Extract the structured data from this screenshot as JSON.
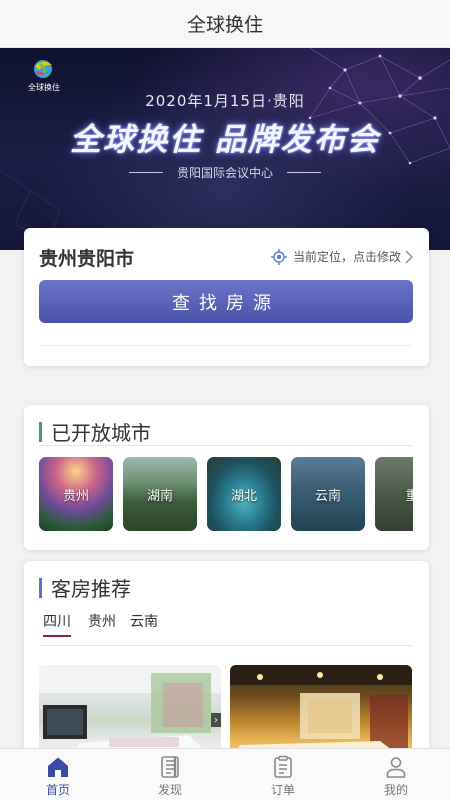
{
  "header": {
    "title": "全球换住"
  },
  "banner": {
    "logo_text": "全球换住",
    "date_line": "2020年1月15日·贵阳",
    "headline": "全球换住 品牌发布会",
    "venue": "贵阳国际会议中心"
  },
  "location": {
    "city": "贵州贵阳市",
    "hint": "当前定位，点击修改",
    "search_label": "查找房源"
  },
  "cities_section": {
    "title": "已开放城市",
    "accent": "#3aa56a",
    "cities": [
      {
        "name": "贵州"
      },
      {
        "name": "湖南"
      },
      {
        "name": "湖北"
      },
      {
        "name": "云南"
      },
      {
        "name": "重"
      }
    ]
  },
  "rooms_section": {
    "title": "客房推荐",
    "accent": "#5a6fd0",
    "tabs": [
      {
        "label": "四川",
        "active": true
      },
      {
        "label": "贵州",
        "active": false
      },
      {
        "label": "云南",
        "active": false
      }
    ],
    "arrow_glyph": "›"
  },
  "bottom_nav": [
    {
      "label": "首页",
      "icon": "home-icon",
      "active": true
    },
    {
      "label": "发现",
      "icon": "discover-icon",
      "active": false
    },
    {
      "label": "订单",
      "icon": "order-icon",
      "active": false
    },
    {
      "label": "我的",
      "icon": "profile-icon",
      "active": false
    }
  ],
  "colors": {
    "primary": "#4a53a8",
    "nav_active": "#3a4aa8",
    "tab_underline": "#8a1c4a"
  }
}
